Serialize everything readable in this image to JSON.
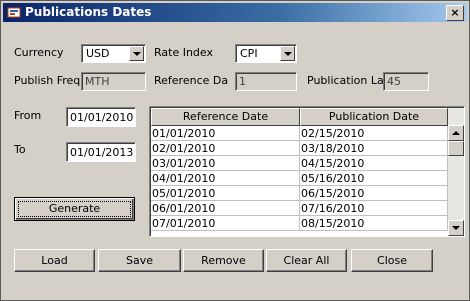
{
  "window": {
    "title": "Publications Dates",
    "close_glyph": "×"
  },
  "currency": {
    "label": "Currency",
    "value": "USD"
  },
  "rate_index": {
    "label": "Rate Index",
    "value": "CPI"
  },
  "publish_freq": {
    "label": "Publish Freq",
    "value": "MTH"
  },
  "reference_day": {
    "label": "Reference Da",
    "value": "1"
  },
  "publication_lag": {
    "label": "Publication Lag",
    "value": "45"
  },
  "from": {
    "label": "From",
    "value": "01/01/2010"
  },
  "to": {
    "label": "To",
    "value": "01/01/2013"
  },
  "generate_label": "Generate",
  "table": {
    "headers": [
      "Reference Date",
      "Publication Date"
    ],
    "rows": [
      [
        "01/01/2010",
        "02/15/2010"
      ],
      [
        "02/01/2010",
        "03/18/2010"
      ],
      [
        "03/01/2010",
        "04/15/2010"
      ],
      [
        "04/01/2010",
        "05/16/2010"
      ],
      [
        "05/01/2010",
        "06/15/2010"
      ],
      [
        "06/01/2010",
        "07/16/2010"
      ],
      [
        "07/01/2010",
        "08/15/2010"
      ]
    ]
  },
  "buttons": {
    "load": "Load",
    "save": "Save",
    "remove": "Remove",
    "clear_all": "Clear All",
    "close": "Close"
  }
}
